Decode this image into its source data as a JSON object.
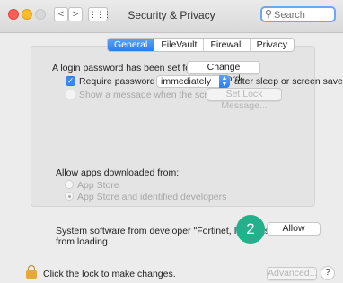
{
  "window": {
    "title": "Security & Privacy",
    "search_placeholder": "Search",
    "nav": {
      "back": "<",
      "forward": ">",
      "grid": "⋮⋮⋮"
    }
  },
  "tabs": [
    {
      "label": "General",
      "active": true
    },
    {
      "label": "FileVault",
      "active": false
    },
    {
      "label": "Firewall",
      "active": false
    },
    {
      "label": "Privacy",
      "active": false
    }
  ],
  "general": {
    "password_set_text": "A login password has been set for this user",
    "change_password_label": "Change Password...",
    "require_password_label": "Require password",
    "require_password_value": "immediately",
    "require_password_suffix": "after sleep or screen saver begins",
    "show_message_label": "Show a message when the screen is locked",
    "set_lock_message_label": "Set Lock Message...",
    "allow_apps_title": "Allow apps downloaded from:",
    "option_app_store": "App Store",
    "option_app_store_identified": "App Store and identified developers",
    "blocked_text_line1": "System software from developer \"Fortinet, Inc\" was blocked",
    "blocked_text_line2": "from loading.",
    "allow_label": "Allow"
  },
  "annotation_badge": "2",
  "footer": {
    "lock_text": "Click the lock to make changes.",
    "advanced_label": "Advanced...",
    "help_label": "?"
  },
  "colors": {
    "accent": "#2a7ef0",
    "badge": "#24b08a",
    "lock": "#e7a83b"
  }
}
